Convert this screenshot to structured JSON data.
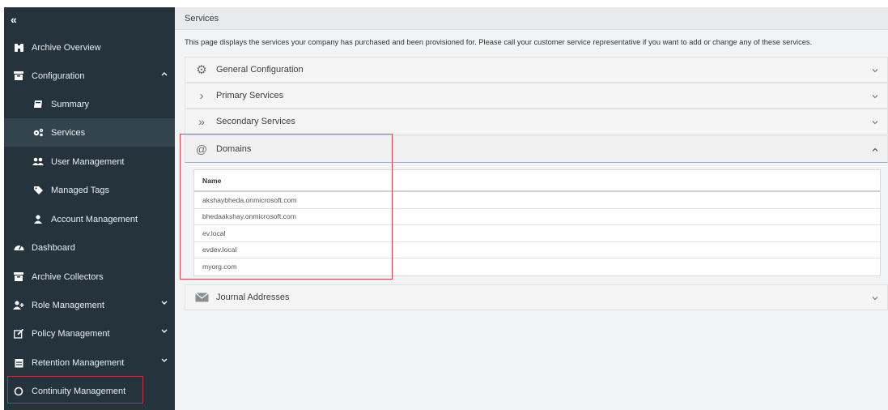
{
  "sidebar": {
    "collapse_glyph": "«",
    "items": [
      {
        "label": "Archive Overview",
        "icon": "binoculars-icon"
      },
      {
        "label": "Configuration",
        "icon": "archive-box-icon"
      },
      {
        "label": "Summary",
        "icon": "book-icon"
      },
      {
        "label": "Services",
        "icon": "cogs-icon"
      },
      {
        "label": "User Management",
        "icon": "users-icon"
      },
      {
        "label": "Managed Tags",
        "icon": "tag-icon"
      },
      {
        "label": "Account Management",
        "icon": "user-icon"
      },
      {
        "label": "Dashboard",
        "icon": "dashboard-icon"
      },
      {
        "label": "Archive Collectors",
        "icon": "archive-box-icon"
      },
      {
        "label": "Role Management",
        "icon": "user-plus-icon"
      },
      {
        "label": "Policy Management",
        "icon": "edit-icon"
      },
      {
        "label": "Retention Management",
        "icon": "calendar-icon"
      },
      {
        "label": "Continuity Management",
        "icon": "circle-icon"
      }
    ],
    "active_item": "Services"
  },
  "main": {
    "title": "Services",
    "description": "This page displays the services your company has purchased and been provisioned for. Please call your customer service representative if you want to add or change any of these services.",
    "panels": [
      {
        "label": "General Configuration",
        "icon": "gear-icon",
        "glyph": "⚙",
        "expanded": false
      },
      {
        "label": "Primary Services",
        "icon": "chevron-right-icon",
        "glyph": "›",
        "expanded": false
      },
      {
        "label": "Secondary Services",
        "icon": "double-chevron-right-icon",
        "glyph": "»",
        "expanded": false
      },
      {
        "label": "Domains",
        "icon": "at-icon",
        "glyph": "@",
        "expanded": true
      },
      {
        "label": "Journal Addresses",
        "icon": "envelope-icon",
        "glyph": "✉",
        "expanded": false
      }
    ],
    "domains_table": {
      "header": "Name",
      "rows": [
        "akshaybheda.onmicrosoft.com",
        "bhedaakshay.onmicrosoft.com",
        "ev.local",
        "evdev.local",
        "myorg.com"
      ]
    }
  },
  "colors": {
    "sidebar_bg": "#25333d",
    "sidebar_active": "#33444f",
    "highlight_red": "#d64550",
    "panel_bg": "#f5f5f5"
  }
}
